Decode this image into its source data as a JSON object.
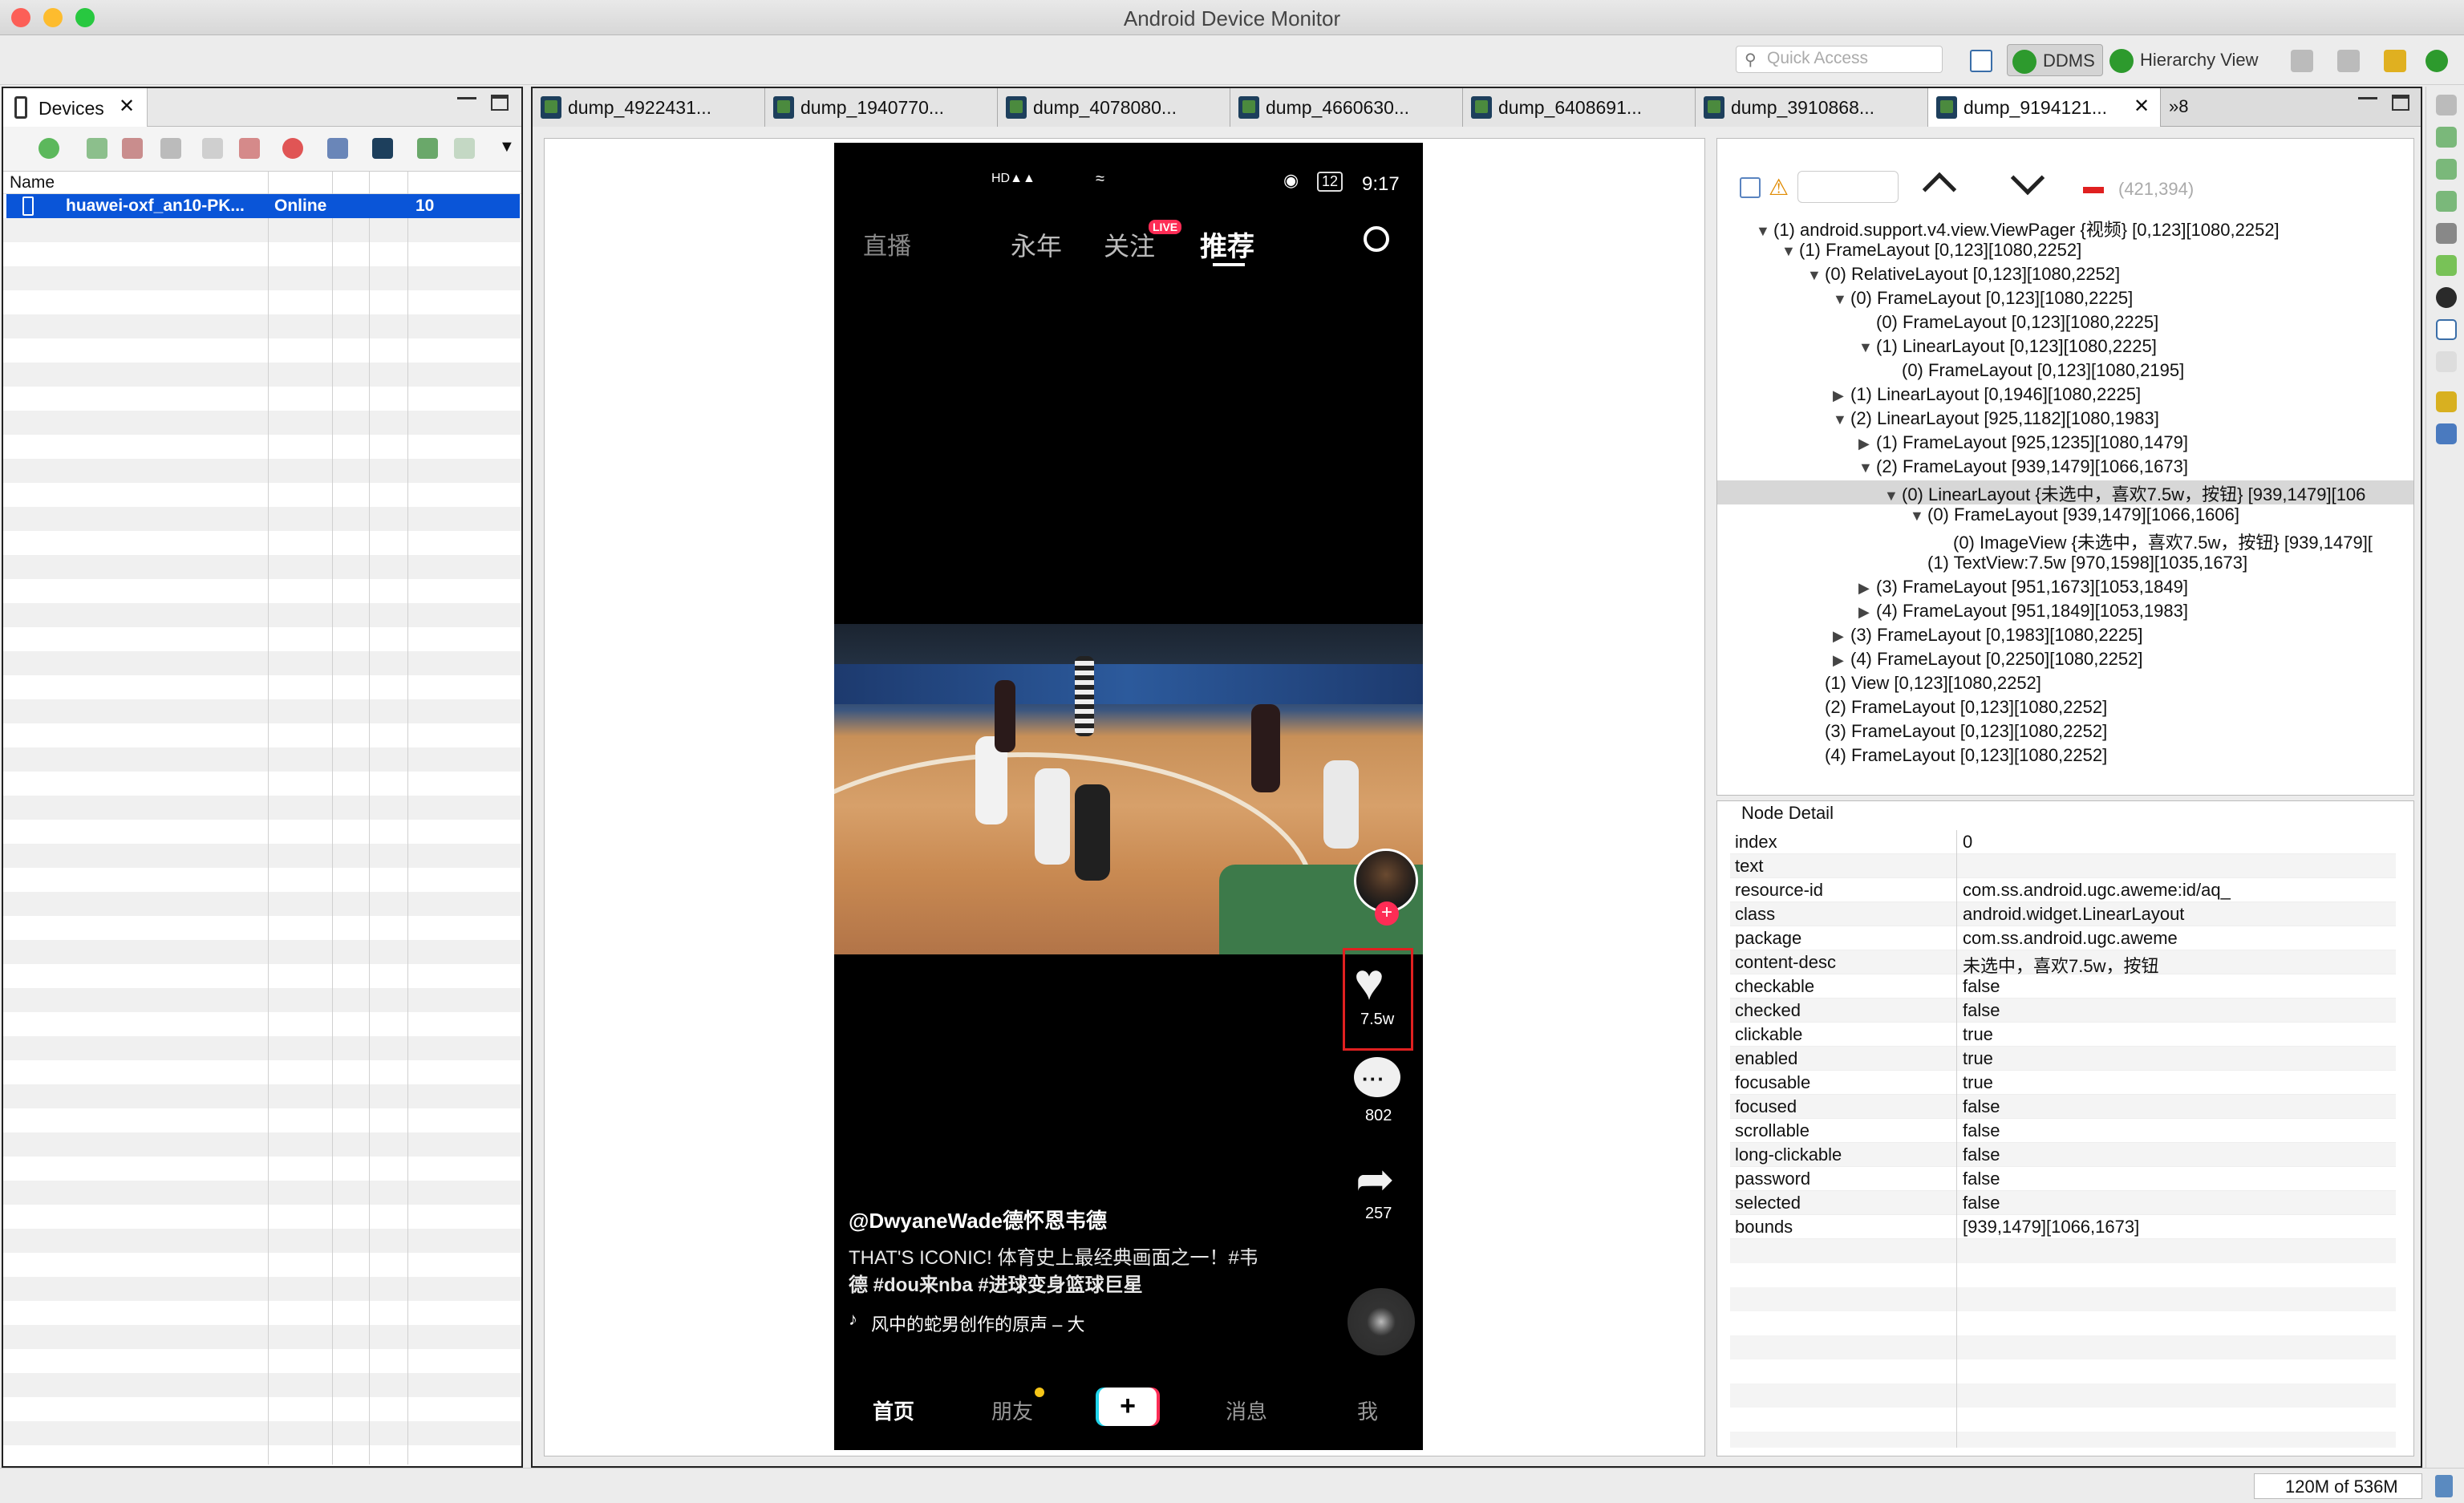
{
  "window": {
    "title": "Android Device Monitor"
  },
  "toolbar": {
    "quick_access_placeholder": "Quick Access",
    "perspectives": [
      "DDMS",
      "Hierarchy View"
    ]
  },
  "devices_view": {
    "tab_label": "Devices",
    "column_name": "Name",
    "device": {
      "name": "huawei-oxf_an10-PK...",
      "state": "Online",
      "api": "10"
    }
  },
  "editor_tabs": [
    "dump_4922431...",
    "dump_1940770...",
    "dump_4078080...",
    "dump_4660630...",
    "dump_6408691...",
    "dump_3910868...",
    "dump_9194121..."
  ],
  "tab_overflow": "»8",
  "phone": {
    "status": {
      "time": "9:17",
      "battery": "12"
    },
    "top_tabs": {
      "live": "直播",
      "city": "永年",
      "follow": "关注",
      "live_badge": "LIVE",
      "recommend": "推荐"
    },
    "like_count": "7.5w",
    "comment_count": "802",
    "share_count": "257",
    "author": "@DwyaneWade德怀恩韦德",
    "caption_line1": "THAT'S ICONIC! 体育史上最经典画面之一！#韦",
    "caption_line2": "德 #dou来nba #进球变身篮球巨星",
    "music": "风中的蛇男创作的原声 – 大",
    "nav": {
      "home": "首页",
      "friends": "朋友",
      "plus": "+",
      "messages": "消息",
      "me": "我"
    },
    "colors": {
      "accent": "#fe2c55",
      "highlight_box": "#e02020"
    }
  },
  "hierarchy": {
    "coords": "(421,394)",
    "rows": [
      {
        "indent": 0,
        "tri": "▼",
        "text": "(1) android.support.v4.view.ViewPager {视频} [0,123][1080,2252]"
      },
      {
        "indent": 1,
        "tri": "▼",
        "text": "(1) FrameLayout [0,123][1080,2252]"
      },
      {
        "indent": 2,
        "tri": "▼",
        "text": "(0) RelativeLayout [0,123][1080,2252]"
      },
      {
        "indent": 3,
        "tri": "▼",
        "text": "(0) FrameLayout [0,123][1080,2225]"
      },
      {
        "indent": 4,
        "tri": "",
        "text": "(0) FrameLayout [0,123][1080,2225]"
      },
      {
        "indent": 4,
        "tri": "▼",
        "text": "(1) LinearLayout [0,123][1080,2225]"
      },
      {
        "indent": 5,
        "tri": "",
        "text": "(0) FrameLayout [0,123][1080,2195]"
      },
      {
        "indent": 3,
        "tri": "▶",
        "text": "(1) LinearLayout [0,1946][1080,2225]"
      },
      {
        "indent": 3,
        "tri": "▼",
        "text": "(2) LinearLayout [925,1182][1080,1983]"
      },
      {
        "indent": 4,
        "tri": "▶",
        "text": "(1) FrameLayout [925,1235][1080,1479]"
      },
      {
        "indent": 4,
        "tri": "▼",
        "text": "(2) FrameLayout [939,1479][1066,1673]"
      },
      {
        "indent": 5,
        "tri": "▼",
        "text": "(0) LinearLayout {未选中，喜欢7.5w，按钮} [939,1479][106",
        "selected": true
      },
      {
        "indent": 6,
        "tri": "▼",
        "text": "(0) FrameLayout [939,1479][1066,1606]"
      },
      {
        "indent": 7,
        "tri": "",
        "text": "(0) ImageView {未选中，喜欢7.5w，按钮} [939,1479]["
      },
      {
        "indent": 6,
        "tri": "",
        "text": "(1) TextView:7.5w [970,1598][1035,1673]"
      },
      {
        "indent": 4,
        "tri": "▶",
        "text": "(3) FrameLayout [951,1673][1053,1849]"
      },
      {
        "indent": 4,
        "tri": "▶",
        "text": "(4) FrameLayout [951,1849][1053,1983]"
      },
      {
        "indent": 3,
        "tri": "▶",
        "text": "(3) FrameLayout [0,1983][1080,2225]"
      },
      {
        "indent": 3,
        "tri": "▶",
        "text": "(4) FrameLayout [0,2250][1080,2252]"
      },
      {
        "indent": 2,
        "tri": "",
        "text": "(1) View [0,123][1080,2252]"
      },
      {
        "indent": 2,
        "tri": "",
        "text": "(2) FrameLayout [0,123][1080,2252]"
      },
      {
        "indent": 2,
        "tri": "",
        "text": "(3) FrameLayout [0,123][1080,2252]"
      },
      {
        "indent": 2,
        "tri": "",
        "text": "(4) FrameLayout [0,123][1080,2252]"
      }
    ]
  },
  "node_detail": {
    "title": "Node Detail",
    "rows": [
      {
        "k": "index",
        "v": "0"
      },
      {
        "k": "text",
        "v": ""
      },
      {
        "k": "resource-id",
        "v": "com.ss.android.ugc.aweme:id/aq_"
      },
      {
        "k": "class",
        "v": "android.widget.LinearLayout"
      },
      {
        "k": "package",
        "v": "com.ss.android.ugc.aweme"
      },
      {
        "k": "content-desc",
        "v": "未选中，喜欢7.5w，按钮"
      },
      {
        "k": "checkable",
        "v": "false"
      },
      {
        "k": "checked",
        "v": "false"
      },
      {
        "k": "clickable",
        "v": "true"
      },
      {
        "k": "enabled",
        "v": "true"
      },
      {
        "k": "focusable",
        "v": "true"
      },
      {
        "k": "focused",
        "v": "false"
      },
      {
        "k": "scrollable",
        "v": "false"
      },
      {
        "k": "long-clickable",
        "v": "false"
      },
      {
        "k": "password",
        "v": "false"
      },
      {
        "k": "selected",
        "v": "false"
      },
      {
        "k": "bounds",
        "v": "[939,1479][1066,1673]"
      }
    ]
  },
  "status_bar": {
    "memory": "120M of 536M"
  }
}
